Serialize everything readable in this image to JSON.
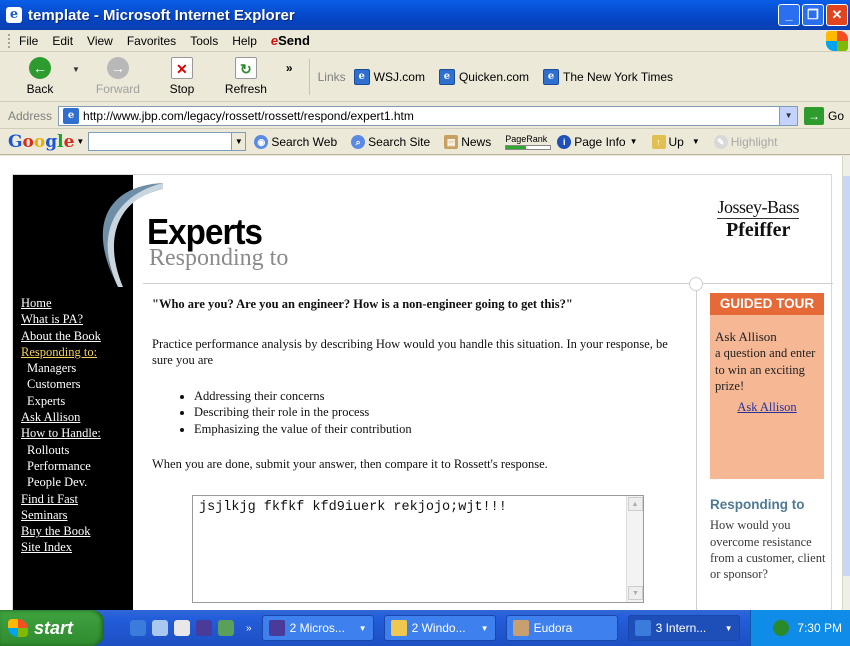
{
  "window": {
    "title": "template - Microsoft Internet Explorer",
    "icon": "ie-page-icon",
    "controls": [
      "minimize",
      "maximize",
      "close"
    ]
  },
  "menu": {
    "items": [
      "File",
      "Edit",
      "View",
      "Favorites",
      "Tools",
      "Help"
    ],
    "send": "Send",
    "send_prefix": "e"
  },
  "toolbar": {
    "back": "Back",
    "forward": "Forward",
    "stop": "Stop",
    "refresh": "Refresh",
    "more": "»",
    "links_label": "Links",
    "links": [
      "WSJ.com",
      "Quicken.com",
      "The New York Times"
    ]
  },
  "address": {
    "label": "Address",
    "url": "http://www.jbp.com/legacy/rossett/rossett/respond/expert1.htm",
    "go": "Go"
  },
  "google": {
    "logo": "Google",
    "search_web": "Search Web",
    "search_site": "Search Site",
    "news": "News",
    "pagerank": "PageRank",
    "page_info": "Page Info",
    "up": "Up",
    "highlight": "Highlight"
  },
  "page": {
    "title": "Experts",
    "subtitle": "Responding to",
    "publisher_line1": "Jossey-Bass",
    "publisher_line2": "Pfeiffer",
    "nav": [
      {
        "label": "Home",
        "type": "top"
      },
      {
        "label": "What is PA?",
        "type": "top"
      },
      {
        "label": "About the Book",
        "type": "top"
      },
      {
        "label": "Responding to:",
        "type": "active"
      },
      {
        "label": "Managers",
        "type": "sub"
      },
      {
        "label": "Customers",
        "type": "sub"
      },
      {
        "label": "Experts",
        "type": "sub"
      },
      {
        "label": "Ask Allison",
        "type": "top"
      },
      {
        "label": "How to Handle:",
        "type": "top"
      },
      {
        "label": "Rollouts",
        "type": "sub"
      },
      {
        "label": "Performance",
        "type": "sub"
      },
      {
        "label": "People Dev.",
        "type": "sub"
      },
      {
        "label": "Find it Fast",
        "type": "top"
      },
      {
        "label": "Seminars",
        "type": "top"
      },
      {
        "label": "Buy the Book",
        "type": "top"
      },
      {
        "label": "Site Index",
        "type": "top"
      }
    ],
    "question": "\"Who are you? Are you an engineer? How is a non-engineer going to get this?\"",
    "intro": "Practice performance analysis by describing How would you handle this situation. In your response, be sure you are",
    "bullets": [
      "Addressing their concerns",
      "Describing their role in the process",
      "Emphasizing the value of their contribution"
    ],
    "submit_text": "When you are done, submit your answer, then compare it to Rossett's response.",
    "response_value": "jsjlkjg fkfkf kfd9iuerk rekjojo;wjt!!!",
    "tour": {
      "header": "GUIDED TOUR",
      "line1": "Ask Allison",
      "line2": "a question and enter to win an exciting prize!",
      "link": "Ask Allison"
    },
    "sidebar_heading": "Responding to",
    "sidebar_text": "How would you overcome resistance from a customer, client or sponsor?"
  },
  "taskbar": {
    "start": "start",
    "tasks": [
      {
        "label": "2 Micros...",
        "icon": "word-icon"
      },
      {
        "label": "2 Windo...",
        "icon": "folder-icon"
      },
      {
        "label": "Eudora",
        "icon": "eudora-icon"
      },
      {
        "label": "3 Intern...",
        "icon": "ie-icon"
      }
    ],
    "clock": "7:30 PM"
  }
}
